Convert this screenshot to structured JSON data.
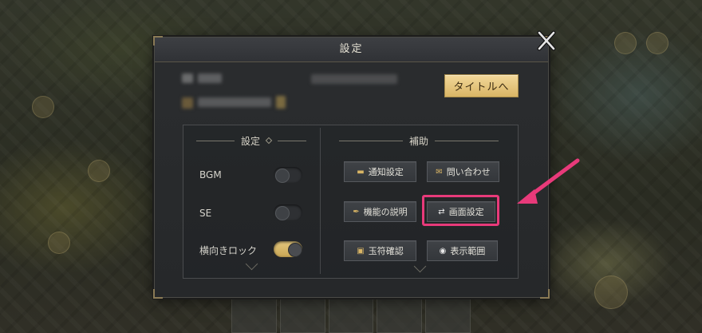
{
  "dialog": {
    "title": "設定",
    "close_icon": "close-x-icon"
  },
  "account": {
    "to_title_label": "タイトルへ"
  },
  "settings_section": {
    "heading": "設定",
    "items": [
      {
        "label": "BGM",
        "enabled": false
      },
      {
        "label": "SE",
        "enabled": false
      },
      {
        "label": "横向きロック",
        "enabled": true
      }
    ]
  },
  "assist_section": {
    "heading": "補助",
    "buttons": [
      {
        "label": "通知設定",
        "icon": "chat-bubble-icon"
      },
      {
        "label": "問い合わせ",
        "icon": "envelope-icon"
      },
      {
        "label": "機能の説明",
        "icon": "quill-icon"
      },
      {
        "label": "画面設定",
        "icon": "swap-arrows-icon"
      },
      {
        "label": "玉符確認",
        "icon": "card-icon"
      },
      {
        "label": "表示範囲",
        "icon": "eye-icon"
      }
    ]
  },
  "colors": {
    "accent_gold": "#d9b565",
    "highlight_pink": "#e83a7a"
  }
}
